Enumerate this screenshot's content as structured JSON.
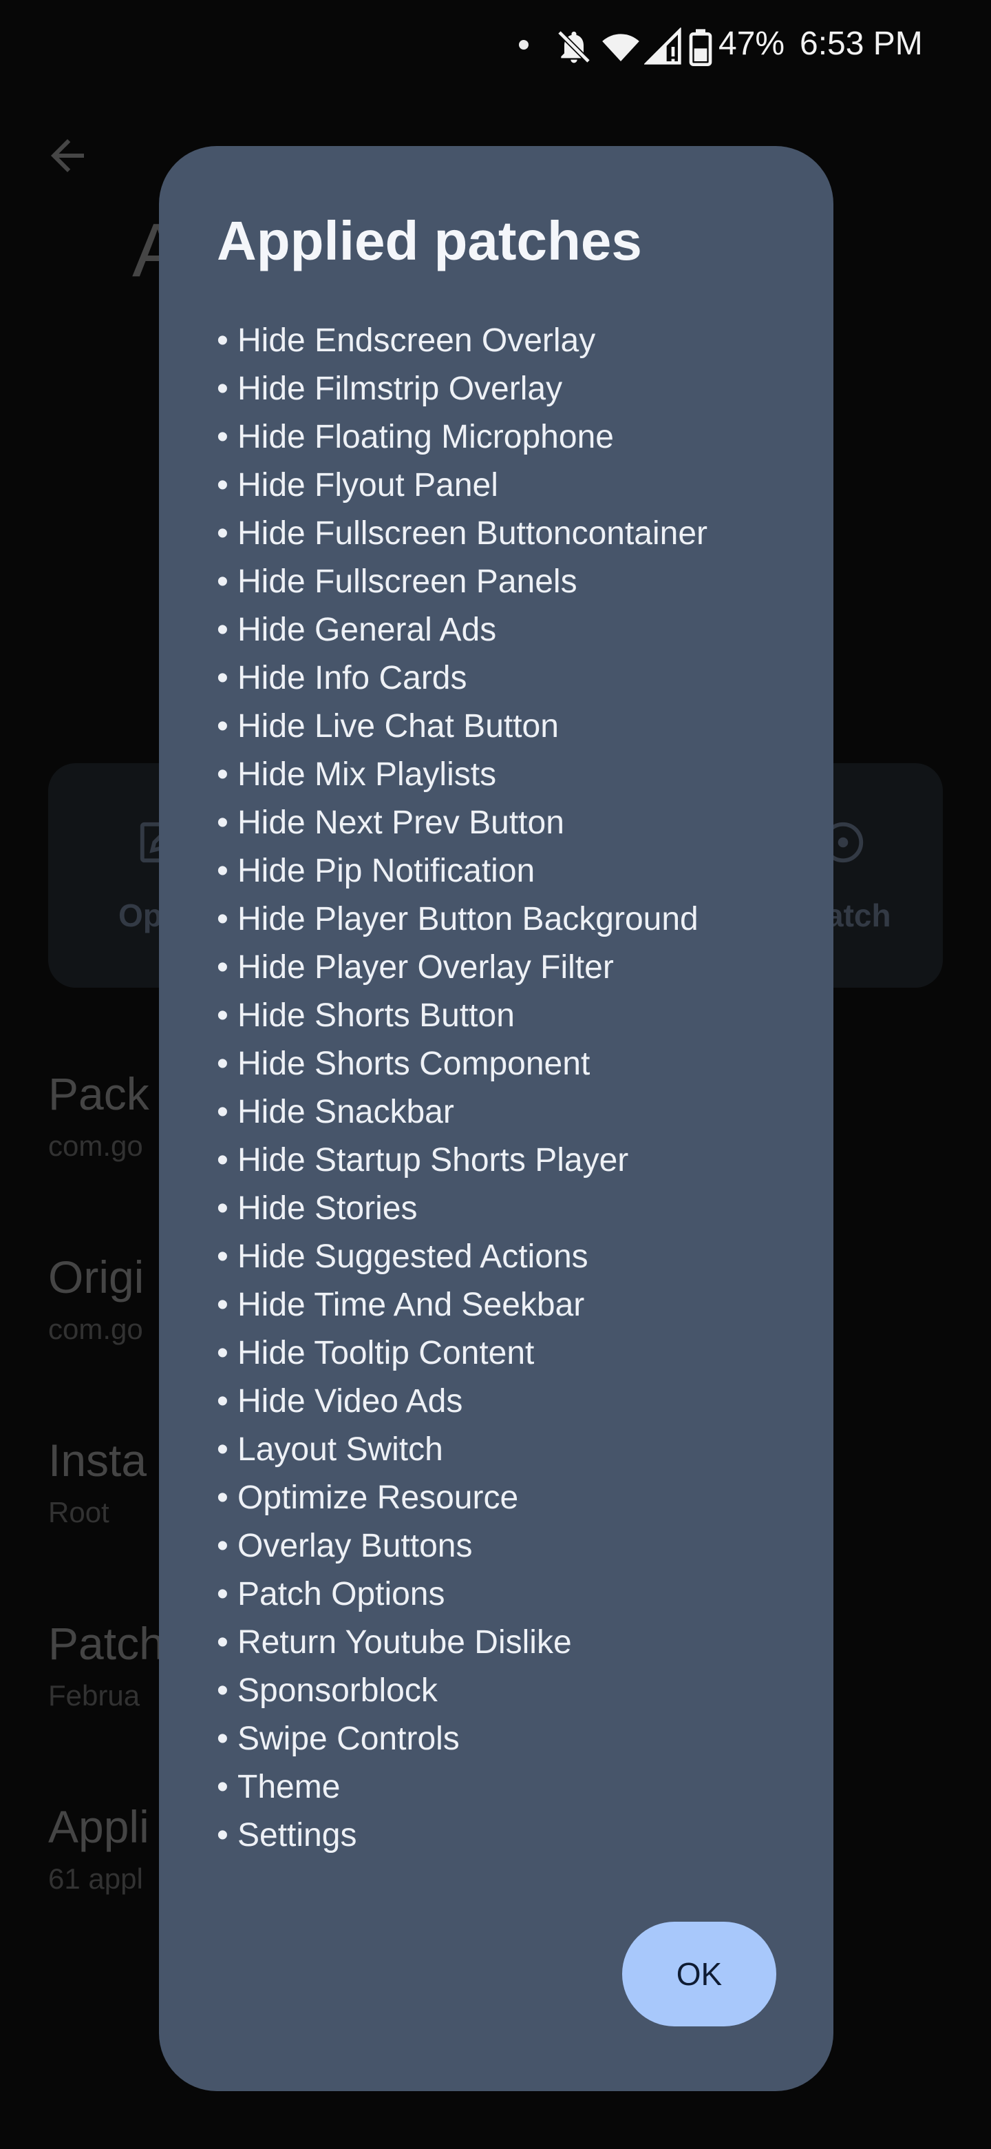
{
  "status_bar": {
    "battery_percent": "47%",
    "time": "6:53 PM",
    "icons": [
      "notification-dot",
      "bell-off-icon",
      "wifi-icon",
      "signal-icon",
      "battery-icon"
    ]
  },
  "background": {
    "back_icon": "arrow-left-icon",
    "title_fragment": "A",
    "actions": {
      "left_label": "Op",
      "right_label": "atch"
    },
    "info": [
      {
        "title": "Pack",
        "sub": "com.go"
      },
      {
        "title": "Origi",
        "sub": "com.go"
      },
      {
        "title": "Insta",
        "sub": "Root"
      },
      {
        "title": "Patch",
        "sub": "Februa"
      },
      {
        "title": "Appli",
        "sub": "61 appl"
      }
    ]
  },
  "dialog": {
    "title": "Applied patches",
    "patches": [
      "Hide Endscreen Overlay",
      "Hide Filmstrip Overlay",
      "Hide Floating Microphone",
      "Hide Flyout Panel",
      "Hide Fullscreen Buttoncontainer",
      "Hide Fullscreen Panels",
      "Hide General Ads",
      "Hide Info Cards",
      "Hide Live Chat Button",
      "Hide Mix Playlists",
      "Hide Next Prev Button",
      "Hide Pip Notification",
      "Hide Player Button Background",
      "Hide Player Overlay Filter",
      "Hide Shorts Button",
      "Hide Shorts Component",
      "Hide Snackbar",
      "Hide Startup Shorts Player",
      "Hide Stories",
      "Hide Suggested Actions",
      "Hide Time And Seekbar",
      "Hide Tooltip Content",
      "Hide Video Ads",
      "Layout Switch",
      "Optimize Resource",
      "Overlay Buttons",
      "Patch Options",
      "Return Youtube Dislike",
      "Sponsorblock",
      "Swipe Controls",
      "Theme",
      "Settings"
    ],
    "ok_label": "OK"
  },
  "colors": {
    "dialog_bg": "#47556a",
    "ok_button_bg": "#a8c8fb",
    "screen_bg": "#0b0b0b"
  }
}
